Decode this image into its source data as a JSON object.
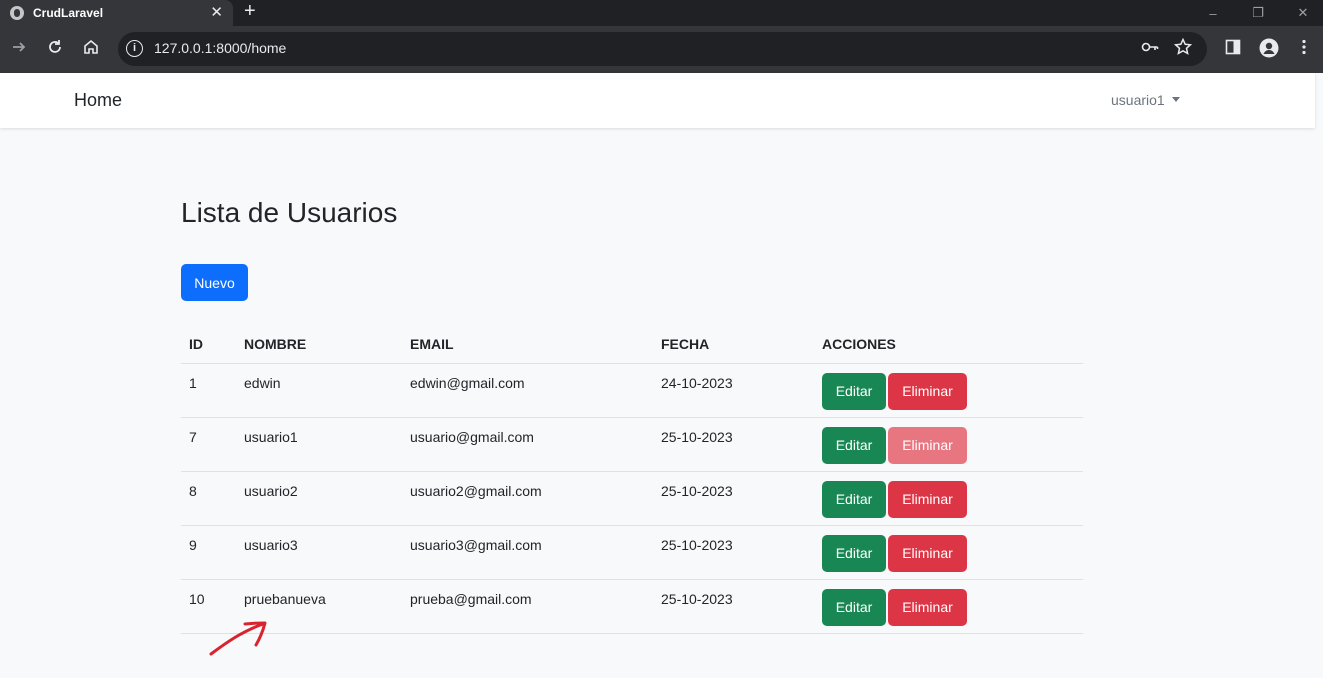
{
  "browser": {
    "tab_title": "CrudLaravel",
    "tab_close": "✕",
    "new_tab": "+",
    "url_host": "127.0.0.1",
    "url_rest": ":8000/home",
    "window_controls": {
      "minimize": "–",
      "restore": "❐",
      "close": "✕"
    }
  },
  "navbar": {
    "brand": "Home",
    "user": "usuario1"
  },
  "main": {
    "title": "Lista de Usuarios",
    "new_button": "Nuevo",
    "columns": [
      "ID",
      "NOMBRE",
      "EMAIL",
      "FECHA",
      "ACCIONES"
    ],
    "rows": [
      {
        "id": "1",
        "name": "edwin",
        "email": "edwin@gmail.com",
        "date": "24-10-2023",
        "edit": "Editar",
        "delete": "Eliminar",
        "delete_disabled": false
      },
      {
        "id": "7",
        "name": "usuario1",
        "email": "usuario@gmail.com",
        "date": "25-10-2023",
        "edit": "Editar",
        "delete": "Eliminar",
        "delete_disabled": true
      },
      {
        "id": "8",
        "name": "usuario2",
        "email": "usuario2@gmail.com",
        "date": "25-10-2023",
        "edit": "Editar",
        "delete": "Eliminar",
        "delete_disabled": false
      },
      {
        "id": "9",
        "name": "usuario3",
        "email": "usuario3@gmail.com",
        "date": "25-10-2023",
        "edit": "Editar",
        "delete": "Eliminar",
        "delete_disabled": false
      },
      {
        "id": "10",
        "name": "pruebanueva",
        "email": "prueba@gmail.com",
        "date": "25-10-2023",
        "edit": "Editar",
        "delete": "Eliminar",
        "delete_disabled": false
      }
    ]
  },
  "colors": {
    "primary": "#0d6efd",
    "success": "#198754",
    "danger": "#dc3545",
    "danger_disabled": "#e77681",
    "annotation_arrow": "#d9232e"
  },
  "icons": [
    "globe-icon",
    "back-arrow-icon",
    "reload-icon",
    "home-icon",
    "info-icon",
    "key-icon",
    "star-icon",
    "sidepanel-icon",
    "profile-icon",
    "menu-dots-icon",
    "caret-down-icon",
    "annotation-arrow"
  ]
}
